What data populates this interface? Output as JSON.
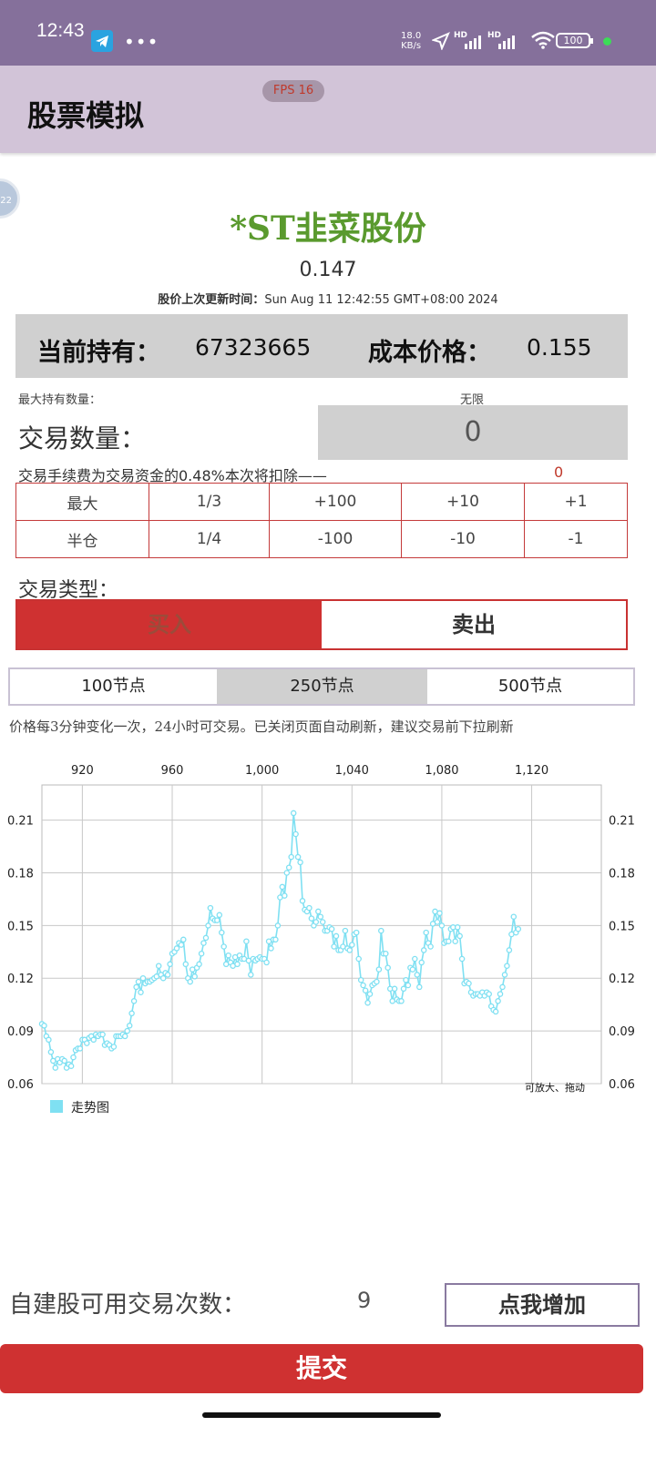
{
  "status_bar": {
    "time": "12:43",
    "speed_value": "18.0",
    "speed_unit": "KB/s",
    "hd1": "HD",
    "hd2": "HD",
    "battery": "100"
  },
  "app_bar": {
    "title": "股票模拟",
    "fps": "FPS 16"
  },
  "stock": {
    "name": "*ST韭菜股份",
    "price": "0.147",
    "update_label": "股价上次更新时间：",
    "update_time": "Sun Aug 11 12:42:55 GMT+08:00 2024"
  },
  "holding": {
    "label": "当前持有：",
    "value": "67323665",
    "cost_label": "成本价格：",
    "cost_value": "0.155"
  },
  "max_hold": {
    "label": "最大持有数量：",
    "value": "无限"
  },
  "quantity": {
    "label": "交易数量：",
    "value": "0"
  },
  "fee": {
    "text": "交易手续费为交易资金的0.48%本次将扣除——",
    "value": "0"
  },
  "qty_buttons": [
    [
      "最大",
      "1/3",
      "+100",
      "+10",
      "+1"
    ],
    [
      "半仓",
      "1/4",
      "-100",
      "-10",
      "-1"
    ]
  ],
  "trade_type": {
    "label": "交易类型：",
    "buy": "买入",
    "sell": "卖出",
    "selected": "buy",
    "active_color": "#cf3131"
  },
  "range_tabs": {
    "items": [
      "100节点",
      "250节点",
      "500节点"
    ],
    "selected": 1
  },
  "note": "价格每3分钟变化一次，24小时可交易。已关闭页面自动刷新，建议交易前下拉刷新",
  "chart_data": {
    "type": "line",
    "x_ticks": [
      "920",
      "960",
      "1,000",
      "1,040",
      "1,080",
      "1,120"
    ],
    "x_tick_values": [
      920,
      960,
      1000,
      1040,
      1080,
      1120
    ],
    "y_ticks": [
      "0.21",
      "0.18",
      "0.15",
      "0.12",
      "0.09",
      "0.06"
    ],
    "xlim": [
      902,
      1151
    ],
    "ylim": [
      0.06,
      0.23
    ],
    "grid": true,
    "legend": "bottom-left",
    "color": "#7fe0f2",
    "series": [
      {
        "name": "走势图",
        "x_start": 902,
        "values": [
          0.094,
          0.093,
          0.087,
          0.085,
          0.078,
          0.073,
          0.069,
          0.074,
          0.072,
          0.074,
          0.073,
          0.069,
          0.071,
          0.07,
          0.075,
          0.079,
          0.08,
          0.08,
          0.085,
          0.085,
          0.083,
          0.086,
          0.087,
          0.085,
          0.088,
          0.087,
          0.088,
          0.088,
          0.082,
          0.083,
          0.082,
          0.08,
          0.081,
          0.087,
          0.087,
          0.087,
          0.088,
          0.087,
          0.09,
          0.093,
          0.1,
          0.107,
          0.115,
          0.118,
          0.112,
          0.12,
          0.117,
          0.118,
          0.118,
          0.119,
          0.12,
          0.121,
          0.127,
          0.122,
          0.12,
          0.123,
          0.122,
          0.128,
          0.134,
          0.135,
          0.137,
          0.14,
          0.139,
          0.142,
          0.128,
          0.12,
          0.118,
          0.125,
          0.121,
          0.126,
          0.128,
          0.134,
          0.14,
          0.143,
          0.15,
          0.16,
          0.154,
          0.153,
          0.153,
          0.156,
          0.146,
          0.138,
          0.128,
          0.133,
          0.129,
          0.127,
          0.132,
          0.128,
          0.133,
          0.131,
          0.131,
          0.141,
          0.13,
          0.122,
          0.131,
          0.13,
          0.131,
          0.132,
          0.131,
          0.131,
          0.129,
          0.141,
          0.137,
          0.142,
          0.142,
          0.15,
          0.166,
          0.172,
          0.167,
          0.18,
          0.183,
          0.189,
          0.214,
          0.202,
          0.189,
          0.186,
          0.164,
          0.159,
          0.158,
          0.16,
          0.154,
          0.15,
          0.152,
          0.158,
          0.155,
          0.152,
          0.147,
          0.147,
          0.149,
          0.148,
          0.138,
          0.144,
          0.136,
          0.136,
          0.138,
          0.147,
          0.137,
          0.136,
          0.139,
          0.145,
          0.146,
          0.131,
          0.119,
          0.116,
          0.113,
          0.106,
          0.111,
          0.116,
          0.117,
          0.118,
          0.125,
          0.147,
          0.134,
          0.134,
          0.126,
          0.114,
          0.107,
          0.114,
          0.108,
          0.107,
          0.107,
          0.114,
          0.119,
          0.116,
          0.126,
          0.125,
          0.131,
          0.122,
          0.115,
          0.129,
          0.136,
          0.146,
          0.14,
          0.138,
          0.151,
          0.158,
          0.152,
          0.157,
          0.15,
          0.14,
          0.141,
          0.141,
          0.148,
          0.149,
          0.141,
          0.149,
          0.144,
          0.131,
          0.117,
          0.118,
          0.117,
          0.112,
          0.11,
          0.111,
          0.111,
          0.11,
          0.112,
          0.11,
          0.112,
          0.111,
          0.104,
          0.102,
          0.101,
          0.107,
          0.111,
          0.115,
          0.122,
          0.127,
          0.136,
          0.145,
          0.155,
          0.146,
          0.148
        ]
      }
    ]
  },
  "zoom_hint": "可放大、拖动",
  "self_trade": {
    "label": "自建股可用交易次数：",
    "value": "9",
    "add_button": "点我增加"
  },
  "submit": "提交"
}
